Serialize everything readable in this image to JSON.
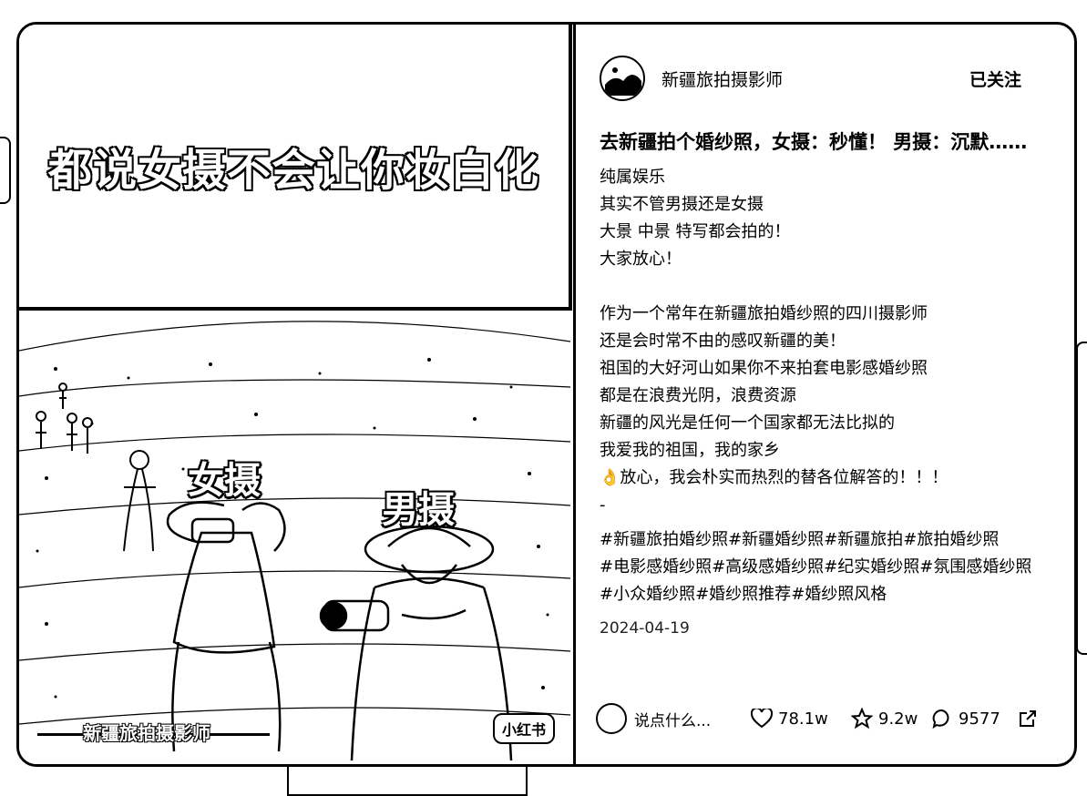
{
  "media": {
    "caption": "都说女摄不会让你妆白化",
    "label_female": "女摄",
    "label_male": "男摄",
    "watermark_author": "新疆旅拍摄影师",
    "watermark_brand": "小红书"
  },
  "author": {
    "name": "新疆旅拍摄影师",
    "follow_label": "已关注"
  },
  "post": {
    "title": "去新疆拍个婚纱照，女摄：秒懂！ 男摄：沉默……",
    "paragraph1": [
      "纯属娱乐",
      "其实不管男摄还是女摄",
      "大景 中景 特写都会拍的！",
      "大家放心！"
    ],
    "paragraph2": [
      "作为一个常年在新疆旅拍婚纱照的四川摄影师",
      "还是会时常不由的感叹新疆的美！",
      "祖国的大好河山如果你不来拍套电影感婚纱照",
      "都是在浪费光阴，浪费资源",
      "新疆的风光是任何一个国家都无法比拟的",
      "我爱我的祖国，我的家乡",
      "👌放心，我会朴实而热烈的替各位解答的！！！"
    ],
    "dash": "-",
    "tags": [
      "#新疆旅拍婚纱照",
      "#新疆婚纱照",
      "#新疆旅拍",
      "#旅拍婚纱照",
      "#电影感婚纱照",
      "#高级感婚纱照",
      "#纪实婚纱照",
      "#氛围感婚纱照",
      " #小众婚纱照",
      "#婚纱照推荐",
      "#婚纱照风格"
    ],
    "date": "2024-04-19"
  },
  "actions": {
    "comment_placeholder": "说点什么...",
    "likes": "78.1w",
    "collects": "9.2w",
    "comments": "9577",
    "icons": [
      "heart-icon",
      "star-icon",
      "comment-icon",
      "share-icon"
    ]
  }
}
